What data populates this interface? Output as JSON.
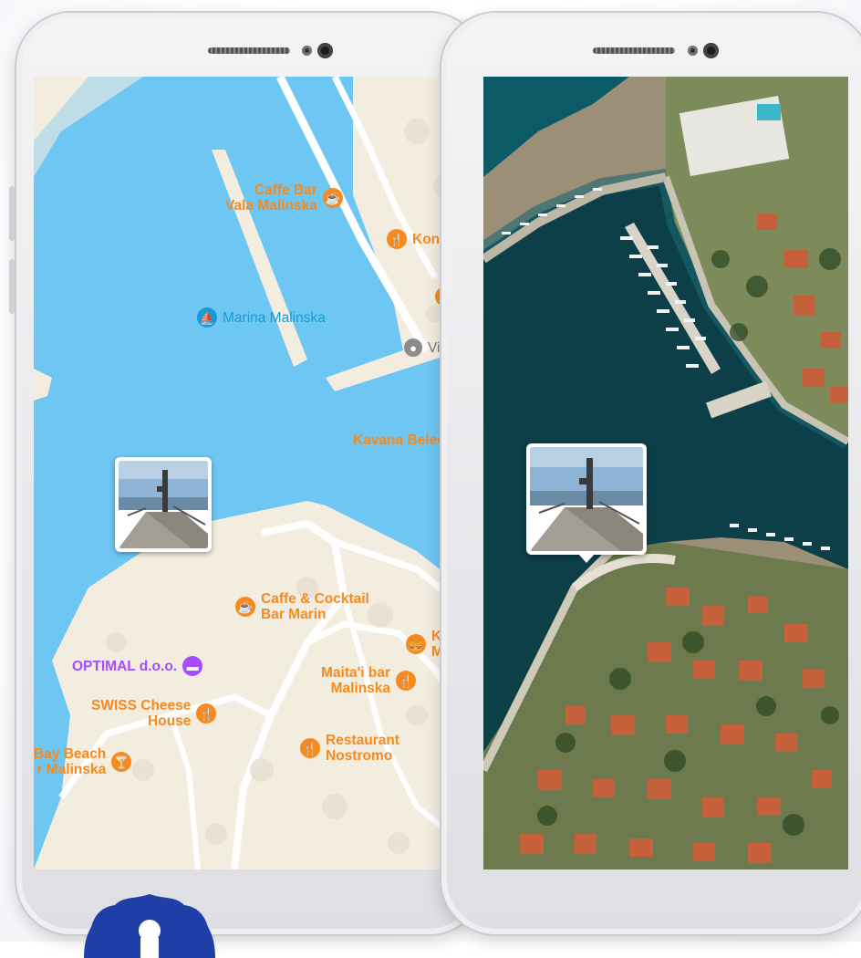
{
  "colors": {
    "water": "#6ec6f2",
    "land": "#f3ede0",
    "poi_orange": "#f68a1e",
    "poi_purple": "#a54dff",
    "marina_blue": "#1a9bd6",
    "gray": "#8c8c8c"
  },
  "left_map": {
    "pois": [
      {
        "name": "poi-caffe-bar-vala",
        "label": "Caffe Bar\nVala Malinska",
        "icon": "coffee-icon",
        "color": "#f68a1e"
      },
      {
        "name": "poi-konoba",
        "label": "Konob",
        "icon": "fork-knife-icon",
        "color": "#f68a1e"
      },
      {
        "name": "poi-marina-malinska",
        "label": "Marina Malinska",
        "icon": "sailboat-icon",
        "color": "#1a9bd6"
      },
      {
        "name": "poi-vitu",
        "label": "Vitu",
        "icon": "circle-icon",
        "color": "#8c8c8c"
      },
      {
        "name": "poi-kavana-beleca",
        "label": "Kavana Beleca",
        "icon": "",
        "color": "#f68a1e"
      },
      {
        "name": "poi-caffe-cocktail-marin",
        "label": "Caffe & Cocktail\nBar Marin",
        "icon": "coffee-icon",
        "color": "#f68a1e"
      },
      {
        "name": "poi-king-mal",
        "label": "King\nMal",
        "icon": "fast-food-icon",
        "color": "#f68a1e"
      },
      {
        "name": "poi-optimal",
        "label": "OPTIMAL d.o.o.",
        "icon": "bed-icon",
        "color": "#a54dff"
      },
      {
        "name": "poi-maitai-bar",
        "label": "Maita'i bar\nMalinska",
        "icon": "fork-knife-icon",
        "color": "#f68a1e"
      },
      {
        "name": "poi-swiss-cheese",
        "label": "SWISS Cheese\nHouse",
        "icon": "fork-knife-icon",
        "color": "#f68a1e"
      },
      {
        "name": "poi-bay-beach",
        "label": "Bay Beach\nr Malinska",
        "icon": "cocktail-icon",
        "color": "#f68a1e"
      },
      {
        "name": "poi-restaurant-nostromo",
        "label": "Restaurant\nNostromo",
        "icon": "fork-knife-icon",
        "color": "#f68a1e"
      }
    ]
  },
  "right_map": {
    "style": "satellite"
  },
  "photo_marker": {
    "description": "pier-photo-icon"
  }
}
